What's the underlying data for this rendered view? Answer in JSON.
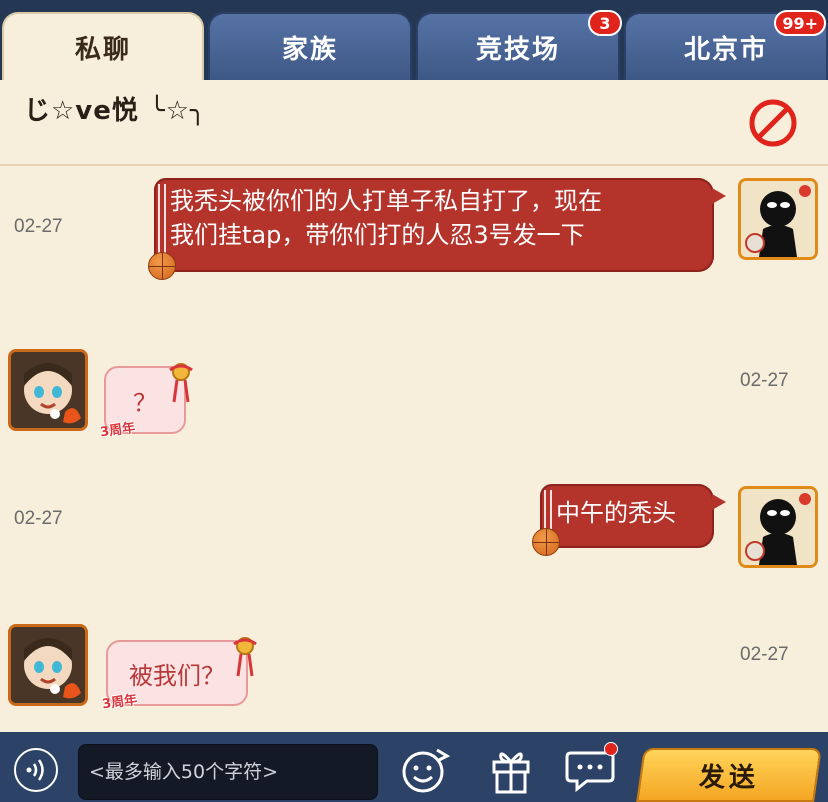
{
  "tabs": [
    {
      "label": "私聊",
      "active": true
    },
    {
      "label": "家族"
    },
    {
      "label": "竞技场",
      "badge": "3"
    },
    {
      "label": "北京市",
      "badge": "99+"
    }
  ],
  "contact": {
    "name": "じ☆ve悦 ╰☆╮"
  },
  "messages": [
    {
      "side": "self",
      "time": "02-27",
      "text_line1": "我秃头被你们的人打单子私自打了，现在",
      "text_line2": "我们挂tap，带你们打的人忍3号发一下"
    },
    {
      "side": "other",
      "time": "02-27",
      "text": "？",
      "tag": "3周年"
    },
    {
      "side": "self",
      "time": "02-27",
      "text": "中午的秃头"
    },
    {
      "side": "other",
      "time": "02-27",
      "text": "被我们？",
      "tag": "3周年"
    }
  ],
  "input": {
    "placeholder": "<最多输入50个字符>"
  },
  "actions": {
    "send_label": "发送"
  },
  "icons": [
    "voice-icon",
    "emoji-icon",
    "gift-icon",
    "message-icon",
    "block-icon"
  ],
  "colors": {
    "tab_bg": "#3e5886",
    "active_tab_bg": "#f7efdc",
    "bubble_out": "#b4332b",
    "bubble_in": "#fbe3e3",
    "send": "#f5a623",
    "badge": "#e0241b"
  }
}
